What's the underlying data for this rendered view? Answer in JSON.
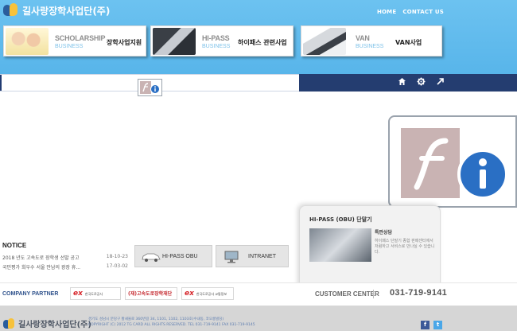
{
  "header": {
    "logo_text": "길사랑장학사업단(주)",
    "nav": [
      "HOME",
      "CONTACT US"
    ]
  },
  "business": [
    {
      "en_title": "SCHOLARSHIP",
      "en_sub": "BUSINESS",
      "ko_label": "장학사업지원"
    },
    {
      "en_title": "HI-PASS",
      "en_sub": "BUSINESS",
      "ko_label": "하이패스 관련사업"
    },
    {
      "en_title": "VAN",
      "en_sub": "BUSINESS",
      "ko_label": "VAN사업"
    }
  ],
  "hipass_panel": {
    "title": "HI-PASS (OBU) 단말기",
    "product_heading": "특판상담",
    "product_desc": "하이패스 단말기 종합 판매센터에서 저렴하고 서비스로 만나실 수 있습니다."
  },
  "notice": {
    "heading": "NOTICE",
    "items": [
      {
        "title": "2018 년도 고속도로 장학생 선발 공고",
        "date": "18-10-23"
      },
      {
        "title": "국민평가 희우수 서울 만남의 광장 휴...",
        "date": "17-03-02"
      }
    ]
  },
  "quick": {
    "hipass_obu": "HI-PASS OBU",
    "intranet": "INTRANET"
  },
  "partner": {
    "heading": "COMPANY PARTNER",
    "logos": [
      {
        "mark": "ex",
        "text": "한국도로공사"
      },
      {
        "mark": "",
        "text": "(재)고속도로장학재단"
      },
      {
        "mark": "ex",
        "text": "한국도로공사 교통정보"
      }
    ],
    "customer_center_label": "CUSTOMER CENTER",
    "phone": "031-719-9141"
  },
  "footer": {
    "logo_text": "길사랑장학사업단(주)",
    "address": "경기도 성남시 분당구 황새울로 360번길 34, 1101, 1102, 1103호(수내동, 코오롱빌딩)",
    "copyright": "COPYRIGHT (C) 2012 TG CARD ALL RIGHTS RESERVED.    TEL 031-719-9141  FAX 031-719-9145",
    "sns": [
      "f",
      "t"
    ]
  },
  "colors": {
    "banner_blue": "#6cc2f0",
    "dark_navy": "#243d70",
    "facebook": "#3b5998",
    "twitter": "#4aa7e8"
  }
}
